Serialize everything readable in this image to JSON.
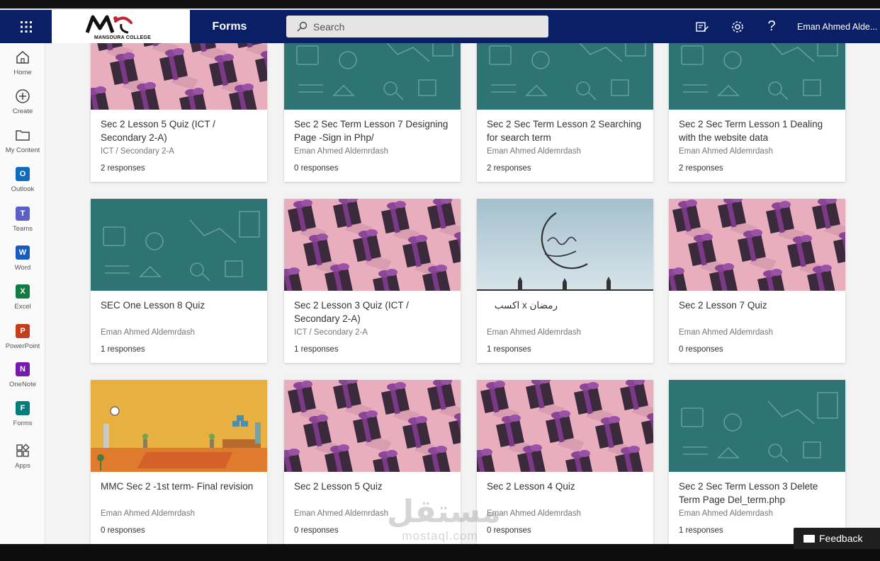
{
  "topbar": {
    "app_name": "Forms",
    "search_placeholder": "Search",
    "logo_text": "MANSOURA COLLEGE",
    "user_name": "Eman Ahmed Alde..."
  },
  "rail": [
    {
      "label": "Home",
      "icon": "home-icon"
    },
    {
      "label": "Create",
      "icon": "plus-circle-icon"
    },
    {
      "label": "My Content",
      "icon": "folder-icon"
    },
    {
      "label": "Outlook",
      "icon": "outlook-icon"
    },
    {
      "label": "Teams",
      "icon": "teams-icon"
    },
    {
      "label": "Word",
      "icon": "word-icon"
    },
    {
      "label": "Excel",
      "icon": "excel-icon"
    },
    {
      "label": "PowerPoint",
      "icon": "powerpoint-icon"
    },
    {
      "label": "OneNote",
      "icon": "onenote-icon"
    },
    {
      "label": "Forms",
      "icon": "forms-icon"
    },
    {
      "label": "Apps",
      "icon": "apps-icon"
    }
  ],
  "cards": [
    {
      "title": "Sec 2 Lesson 5 Quiz (ICT / Secondary 2-A)",
      "subtitle": "ICT / Secondary 2-A",
      "responses": "2 responses",
      "theme": "gifts"
    },
    {
      "title": "Sec 2 Sec Term Lesson 7 Designing Page -Sign in Php/",
      "subtitle": "Eman Ahmed Aldemrdash",
      "responses": "0 responses",
      "theme": "teal"
    },
    {
      "title": "Sec 2 Sec Term Lesson 2 Searching for search term",
      "subtitle": "Eman Ahmed Aldemrdash",
      "responses": "2 responses",
      "theme": "teal"
    },
    {
      "title": "Sec 2 Sec Term Lesson 1 Dealing with the website data",
      "subtitle": "Eman Ahmed Aldemrdash",
      "responses": "2 responses",
      "theme": "teal"
    },
    {
      "title": "SEC One Lesson 8 Quiz",
      "subtitle": "Eman Ahmed Aldemrdash",
      "responses": "1 responses",
      "theme": "teal"
    },
    {
      "title": "Sec 2 Lesson 3 Quiz (ICT / Secondary 2-A)",
      "subtitle": "ICT / Secondary 2-A",
      "responses": "1 responses",
      "theme": "gifts"
    },
    {
      "title": "رمضان x اكسب",
      "subtitle": "Eman Ahmed Aldemrdash",
      "responses": "1 responses",
      "theme": "ramadan"
    },
    {
      "title": "Sec 2 Lesson 7 Quiz",
      "subtitle": "Eman Ahmed Aldemrdash",
      "responses": "0 responses",
      "theme": "gifts"
    },
    {
      "title": "MMC Sec 2 -1st term- Final revision",
      "subtitle": "Eman Ahmed Aldemrdash",
      "responses": "0 responses",
      "theme": "room"
    },
    {
      "title": "Sec 2 Lesson 5 Quiz",
      "subtitle": "Eman Ahmed Aldemrdash",
      "responses": "0 responses",
      "theme": "gifts"
    },
    {
      "title": "Sec 2 Lesson 4 Quiz",
      "subtitle": "Eman Ahmed Aldemrdash",
      "responses": "0 responses",
      "theme": "gifts"
    },
    {
      "title": "Sec 2 Sec Term Lesson 3 Delete Term Page Del_term.php",
      "subtitle": "Eman Ahmed Aldemrdash",
      "responses": "1 responses",
      "theme": "teal"
    }
  ],
  "feedback_label": "Feedback",
  "watermark": {
    "arabic": "مستقل",
    "latin": "mostaql.com"
  },
  "colors": {
    "topbar": "#0b1f66",
    "teal": "#2e7474",
    "pink": "#e9aebd",
    "gift": "#3a2a3c",
    "ramadan_sky": "#aec8d3",
    "room_wall": "#e8b040",
    "room_floor": "#e07b2e"
  }
}
